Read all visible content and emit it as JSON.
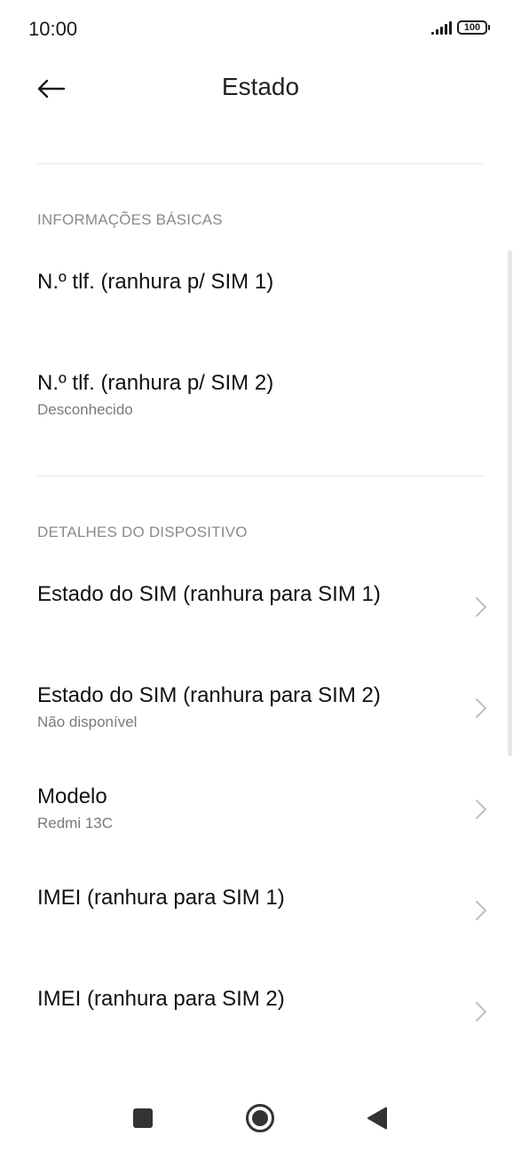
{
  "status_bar": {
    "time": "10:00",
    "battery": "100",
    "signal_icon": "signal-bars-icon",
    "battery_icon": "battery-icon"
  },
  "header": {
    "title": "Estado",
    "back_icon": "arrow-left-icon"
  },
  "sections": [
    {
      "header": "INFORMAÇÕES BÁSICAS",
      "items": [
        {
          "title": "N.º tlf. (ranhura p/ SIM 1)",
          "subtitle": ""
        },
        {
          "title": "N.º tlf. (ranhura p/ SIM 2)",
          "subtitle": "Desconhecido"
        }
      ]
    },
    {
      "header": "DETALHES DO DISPOSITIVO",
      "items": [
        {
          "title": "Estado do SIM (ranhura para SIM 1)",
          "subtitle": ""
        },
        {
          "title": "Estado do SIM (ranhura para SIM 2)",
          "subtitle": "Não disponível"
        },
        {
          "title": "Modelo",
          "subtitle": "Redmi 13C"
        },
        {
          "title": "IMEI (ranhura para SIM 1)",
          "subtitle": ""
        },
        {
          "title": "IMEI (ranhura para SIM 2)",
          "subtitle": ""
        }
      ]
    }
  ],
  "navbar": {
    "recents_icon": "square-icon",
    "home_icon": "circle-home-icon",
    "back_icon": "triangle-back-icon"
  },
  "colors": {
    "text_primary": "#111111",
    "text_secondary": "#7a7a7a",
    "section_header": "#8a8a8a",
    "divider": "#e8e8e8",
    "nav_icon": "#333333"
  }
}
